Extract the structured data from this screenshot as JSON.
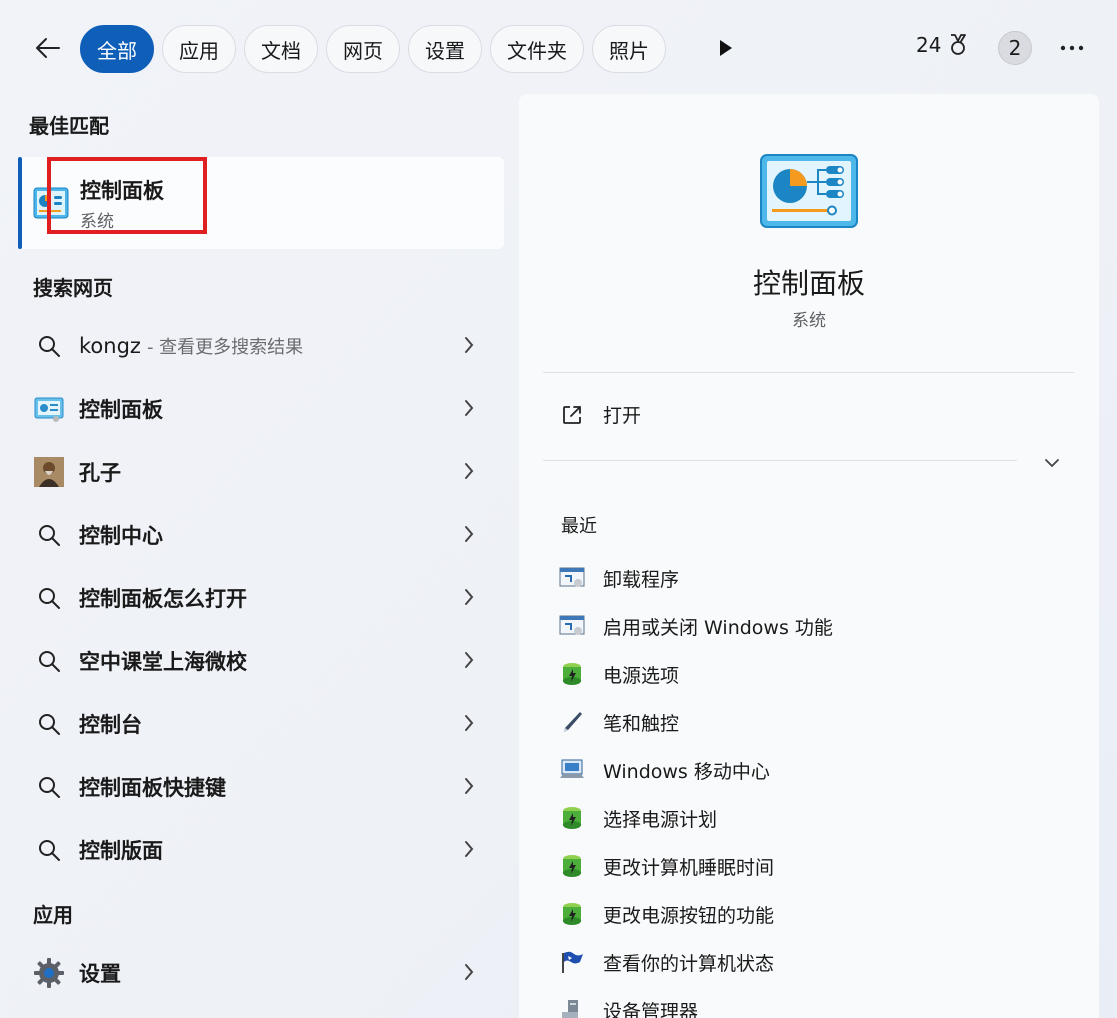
{
  "topbar": {
    "filters": [
      "全部",
      "应用",
      "文档",
      "网页",
      "设置",
      "文件夹",
      "照片"
    ],
    "active_filter": "全部",
    "points": "24",
    "badge": "2"
  },
  "best_match": {
    "section": "最佳匹配",
    "title": "控制面板",
    "subtitle": "系统"
  },
  "web_search": {
    "section": "搜索网页",
    "items": [
      {
        "label": "kongz",
        "hint": "- 查看更多搜索结果",
        "icon": "search-icon"
      },
      {
        "label": "控制面板",
        "icon": "control-panel-icon"
      },
      {
        "label": "孔子",
        "icon": "portrait-thumbnail"
      },
      {
        "label": "控制中心",
        "icon": "search-icon"
      },
      {
        "label": "控制面板怎么打开",
        "icon": "search-icon"
      },
      {
        "label": "空中课堂上海微校",
        "icon": "search-icon"
      },
      {
        "label": "控制台",
        "icon": "search-icon"
      },
      {
        "label": "控制面板快捷键",
        "icon": "search-icon"
      },
      {
        "label": "控制版面",
        "icon": "search-icon"
      }
    ]
  },
  "apps": {
    "section": "应用",
    "items": [
      {
        "label": "设置",
        "icon": "gear-icon"
      }
    ]
  },
  "detail": {
    "title": "控制面板",
    "subtitle": "系统",
    "open_label": "打开",
    "recent_title": "最近",
    "recent": [
      {
        "label": "卸载程序",
        "icon": "programs-icon"
      },
      {
        "label": "启用或关闭 Windows 功能",
        "icon": "programs-icon"
      },
      {
        "label": "电源选项",
        "icon": "power-battery-icon"
      },
      {
        "label": "笔和触控",
        "icon": "pen-icon"
      },
      {
        "label": "Windows 移动中心",
        "icon": "mobility-center-icon"
      },
      {
        "label": "选择电源计划",
        "icon": "power-battery-icon"
      },
      {
        "label": "更改计算机睡眠时间",
        "icon": "power-battery-icon"
      },
      {
        "label": "更改电源按钮的功能",
        "icon": "power-battery-icon"
      },
      {
        "label": "查看你的计算机状态",
        "icon": "flag-icon"
      },
      {
        "label": "设备管理器",
        "icon": "device-manager-icon"
      }
    ]
  },
  "colors": {
    "accent": "#0f5fb8",
    "highlight_box": "#e02020"
  }
}
